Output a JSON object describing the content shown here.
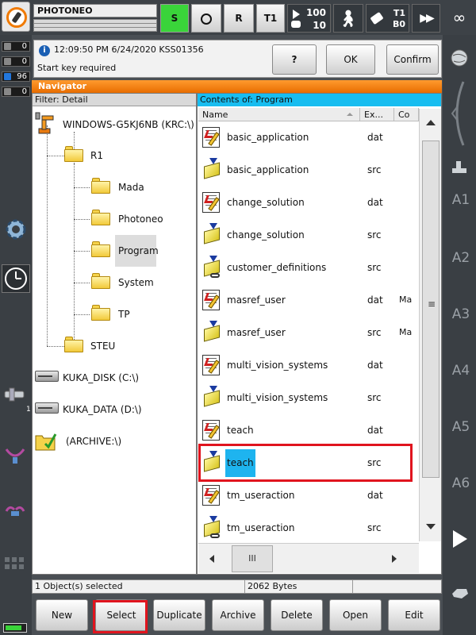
{
  "topbar": {
    "robot_name": "PHOTONEO",
    "btn_s": "S",
    "btn_r": "R",
    "btn_t1": "T1",
    "override_top": "100",
    "override_bottom": "10",
    "mode_t1": "T1",
    "mode_b0": "B0",
    "infinity": "∞"
  },
  "counters": [
    "0",
    "0",
    "96",
    "0"
  ],
  "message": {
    "info_icon": "i",
    "header": "12:09:50 PM 6/24/2020 KSS01356",
    "text": "Start key required",
    "help_label": "?",
    "ok_label": "OK",
    "confirm_all_label": "Confirm all"
  },
  "navigator": {
    "title": "Navigator",
    "filter_label": "Filter: Detail",
    "contents_label": "Contents of: Program",
    "columns": {
      "name": "Name",
      "ext": "Ex...",
      "comment": "Co"
    },
    "tree": [
      {
        "label": "WINDOWS-G5KJ6NB (KRC:\\)",
        "kind": "robot"
      },
      {
        "label": "R1",
        "kind": "folder"
      },
      {
        "label": "Mada",
        "kind": "folder"
      },
      {
        "label": "Photoneo",
        "kind": "folder"
      },
      {
        "label": "Program",
        "kind": "folder",
        "selected": true
      },
      {
        "label": "System",
        "kind": "folder"
      },
      {
        "label": "TP",
        "kind": "folder"
      },
      {
        "label": "STEU",
        "kind": "folder"
      },
      {
        "label": "KUKA_DISK (C:\\)",
        "kind": "drive"
      },
      {
        "label": "KUKA_DATA (D:\\)",
        "kind": "drive"
      },
      {
        "label": "(ARCHIVE:\\)",
        "kind": "archive"
      }
    ],
    "files": [
      {
        "name": "basic_application",
        "ext": "dat",
        "comment": ""
      },
      {
        "name": "basic_application",
        "ext": "src",
        "comment": ""
      },
      {
        "name": "change_solution",
        "ext": "dat",
        "comment": ""
      },
      {
        "name": "change_solution",
        "ext": "src",
        "comment": ""
      },
      {
        "name": "customer_definitions",
        "ext": "src",
        "comment": ""
      },
      {
        "name": "masref_user",
        "ext": "dat",
        "comment": "Ma"
      },
      {
        "name": "masref_user",
        "ext": "src",
        "comment": "Ma"
      },
      {
        "name": "multi_vision_systems",
        "ext": "dat",
        "comment": ""
      },
      {
        "name": "multi_vision_systems",
        "ext": "src",
        "comment": ""
      },
      {
        "name": "teach",
        "ext": "dat",
        "comment": ""
      },
      {
        "name": "teach",
        "ext": "src",
        "comment": "",
        "selected": true
      },
      {
        "name": "tm_useraction",
        "ext": "dat",
        "comment": ""
      },
      {
        "name": "tm_useraction",
        "ext": "src",
        "comment": ""
      }
    ],
    "hscroll_thumb": "III",
    "vscroll_thumb": "≡"
  },
  "statusbar": {
    "selection": "1 Object(s) selected",
    "size": "2062 Bytes"
  },
  "buttons": {
    "new": "New",
    "select": "Select",
    "duplicate": "Duplicate",
    "archive": "Archive",
    "delete": "Delete",
    "open": "Open",
    "edit": "Edit"
  },
  "rightbar": {
    "axes": [
      "A1",
      "A2",
      "A3",
      "A4",
      "A5",
      "A6"
    ]
  },
  "leftbar": {
    "tool_index": "1"
  },
  "colors": {
    "accent_orange": "#f07a00",
    "selection_blue": "#1eb4ef",
    "highlight_red": "#e0141e",
    "status_green": "#3ad43a"
  }
}
